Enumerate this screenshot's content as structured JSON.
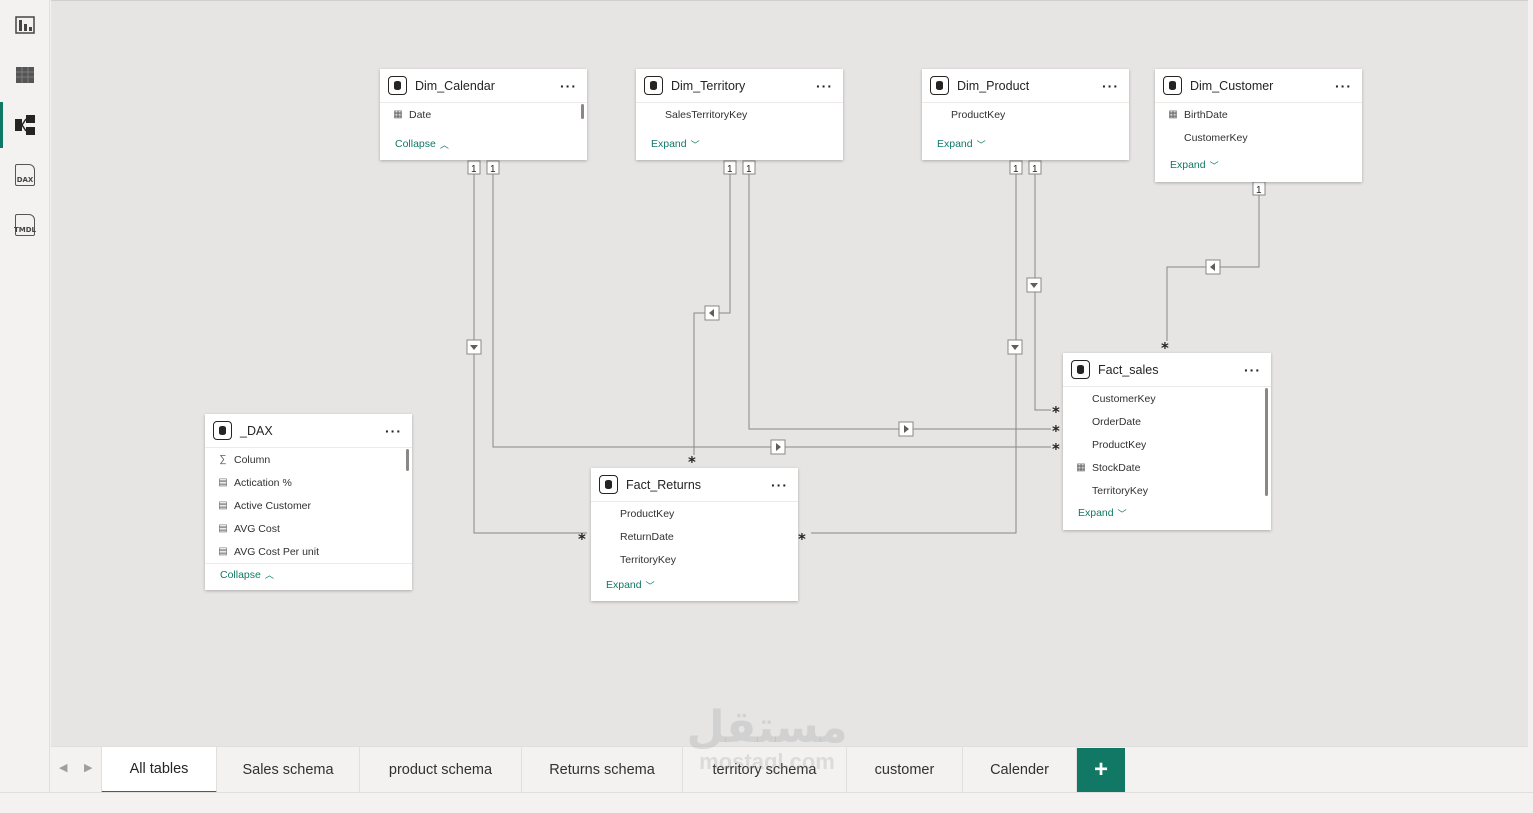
{
  "rail": {
    "items": [
      {
        "name": "report-view",
        "label": ""
      },
      {
        "name": "table-view",
        "label": ""
      },
      {
        "name": "model-view",
        "label": ""
      },
      {
        "name": "dax-query-view",
        "label": "DAX"
      },
      {
        "name": "tmdl-view",
        "label": "TMDL"
      }
    ]
  },
  "tables": {
    "dim_calendar": {
      "title": "Dim_Calendar",
      "fields": [
        "Date"
      ],
      "toggle": "Collapse"
    },
    "dim_territory": {
      "title": "Dim_Territory",
      "fields": [
        "SalesTerritoryKey"
      ],
      "toggle": "Expand"
    },
    "dim_product": {
      "title": "Dim_Product",
      "fields": [
        "ProductKey"
      ],
      "toggle": "Expand"
    },
    "dim_customer": {
      "title": "Dim_Customer",
      "fields": [
        "BirthDate",
        "CustomerKey"
      ],
      "toggle": "Expand"
    },
    "fact_sales": {
      "title": "Fact_sales",
      "fields": [
        "CustomerKey",
        "OrderDate",
        "ProductKey",
        "StockDate",
        "TerritoryKey"
      ],
      "toggle": "Expand"
    },
    "dax": {
      "title": "_DAX",
      "fields": [
        "Column",
        "Actication %",
        "Active Customer",
        "AVG Cost",
        "AVG Cost Per unit"
      ],
      "toggle": "Collapse"
    },
    "fact_returns": {
      "title": "Fact_Returns",
      "fields": [
        "ProductKey",
        "ReturnDate",
        "TerritoryKey"
      ],
      "toggle": "Expand"
    }
  },
  "cardinality": {
    "one": "1",
    "many": "*"
  },
  "tabs": [
    "All tables",
    "Sales schema",
    "product schema",
    "Returns schema",
    "territory schema",
    "customer",
    "Calender"
  ],
  "active_tab": "All tables",
  "add_tab_label": "+",
  "watermark": {
    "line1": "مستقل",
    "line2": "mostaql.com"
  },
  "colors": {
    "accent": "#117865",
    "canvas": "#e6e5e4",
    "line": "#8a8886"
  }
}
